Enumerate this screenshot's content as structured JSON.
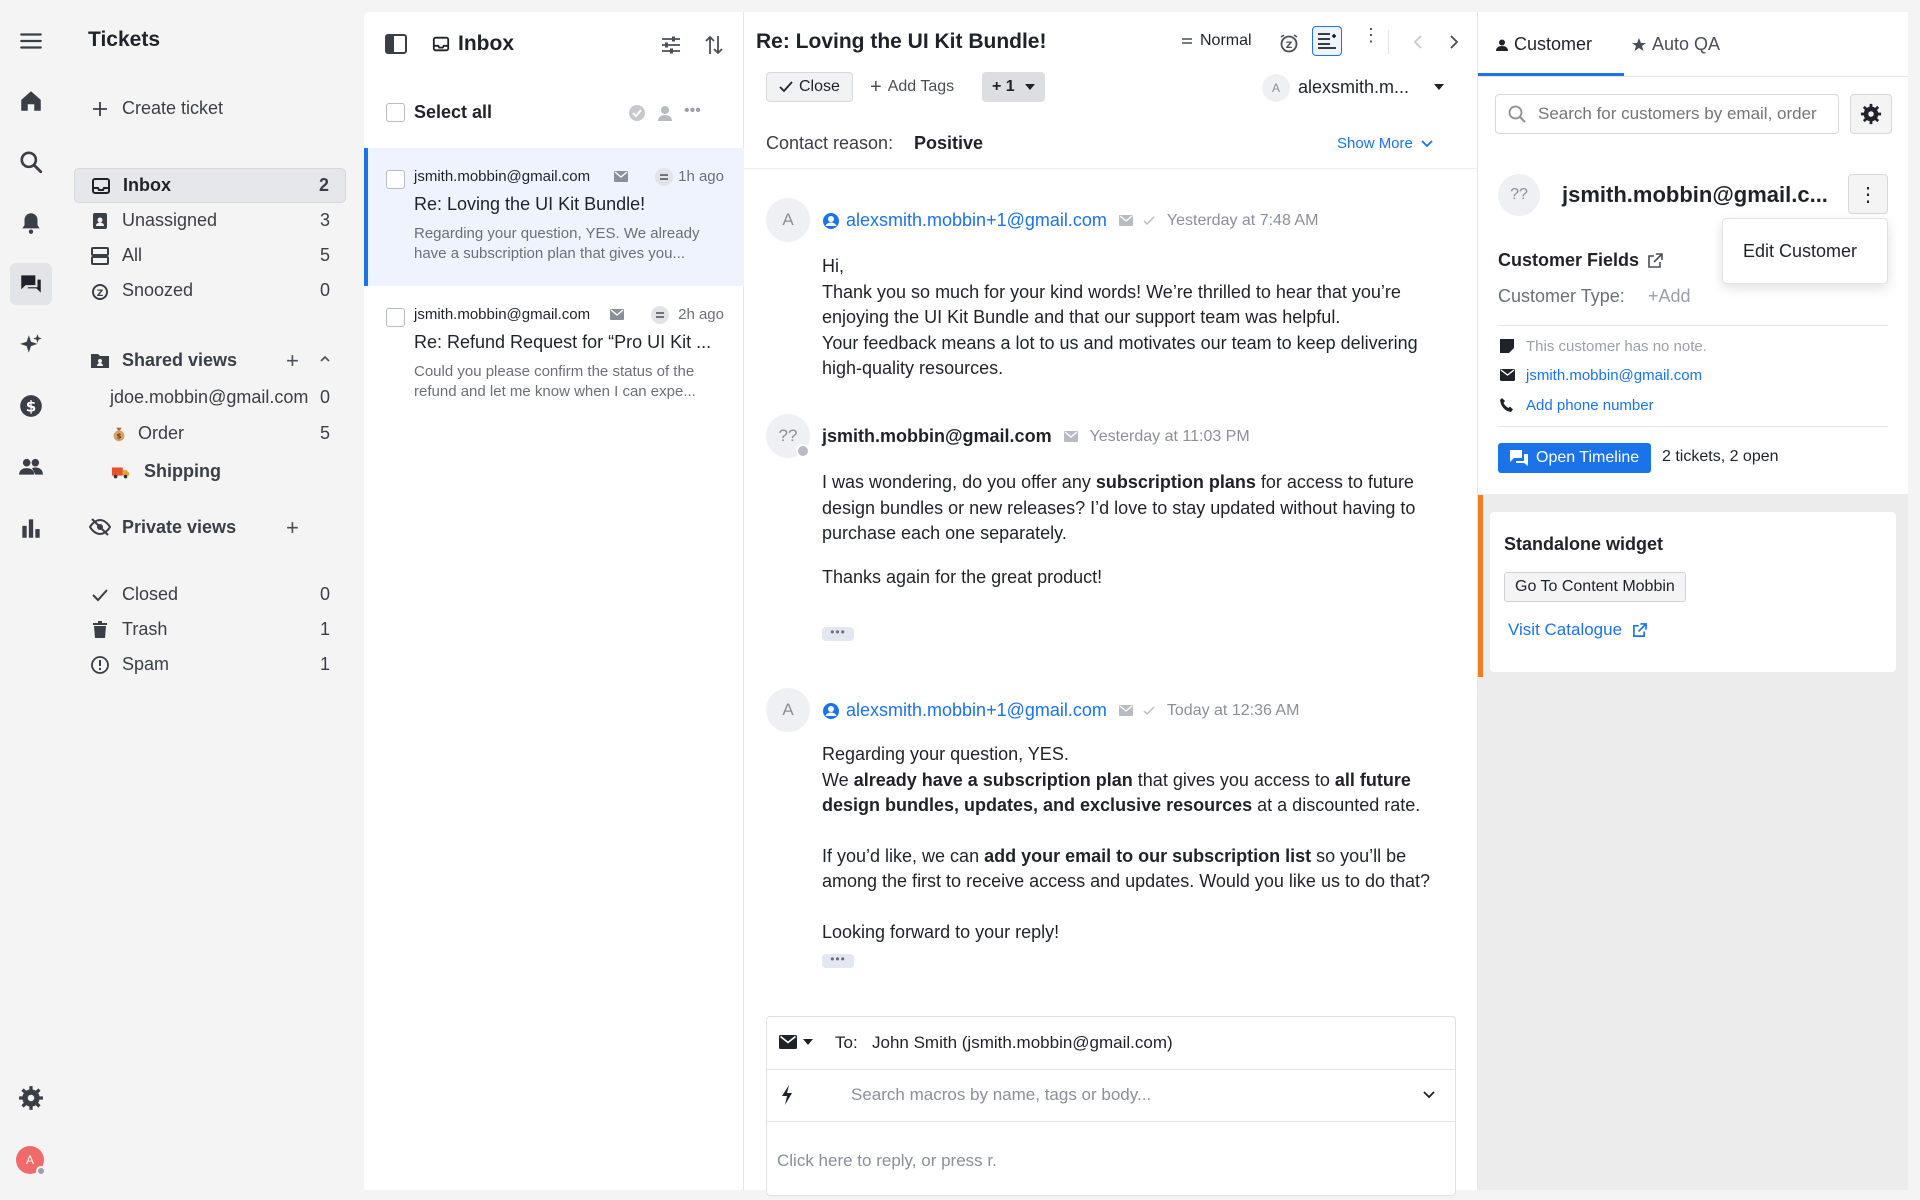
{
  "nav": {
    "title": "Tickets",
    "create_ticket": "Create ticket",
    "items": [
      {
        "label": "Inbox",
        "count": "2"
      },
      {
        "label": "Unassigned",
        "count": "3"
      },
      {
        "label": "All",
        "count": "5"
      },
      {
        "label": "Snoozed",
        "count": "0"
      }
    ],
    "shared_views": {
      "label": "Shared views",
      "items": [
        {
          "label": "jdoe.mobbin@gmail.com",
          "count": "0"
        },
        {
          "label": "Order",
          "count": "5"
        },
        {
          "label": "Shipping",
          "count": ""
        }
      ]
    },
    "private_views": {
      "label": "Private views"
    },
    "system_items": [
      {
        "label": "Closed",
        "count": "0"
      },
      {
        "label": "Trash",
        "count": "1"
      },
      {
        "label": "Spam",
        "count": "1"
      }
    ]
  },
  "user": {
    "initial": "A"
  },
  "list": {
    "title": "Inbox",
    "select_all": "Select all",
    "tickets": [
      {
        "from": "jsmith.mobbin@gmail.com",
        "time": "1h ago",
        "subject": "Re: Loving the UI Kit Bundle!",
        "preview": "Regarding your question, YES. We already have a subscription plan that gives you..."
      },
      {
        "from": "jsmith.mobbin@gmail.com",
        "time": "2h ago",
        "subject": "Re: Refund Request for “Pro UI Kit ...",
        "preview": "Could you please confirm the status of the refund and let me know when I can expe..."
      }
    ]
  },
  "ticket": {
    "title": "Re: Loving the UI Kit Bundle!",
    "priority": "Normal",
    "close_label": "Close",
    "add_tags": "Add Tags",
    "tag_count": "+ 1",
    "assignee_initial": "A",
    "assignee": "alexsmith.m...",
    "contact_reason_label": "Contact reason:",
    "contact_reason_value": "Positive",
    "show_more": "Show More",
    "messages": [
      {
        "avatar": "A",
        "from": "alexsmith.mobbin+1@gmail.com",
        "time": "Yesterday at 7:48 AM",
        "lines": [
          "Hi,",
          "Thank you so much for your kind words! We’re thrilled to hear that you’re enjoying the UI Kit Bundle and that our support team was helpful.",
          "Your feedback means a lot to us and motivates our team to keep delivering high-quality resources."
        ]
      },
      {
        "avatar": "??",
        "from": "jsmith.mobbin@gmail.com",
        "time": "Yesterday at 11:03 PM",
        "p1_a": "I was wondering, do you offer any ",
        "p1_b": "subscription plans",
        "p1_c": " for access to future design bundles or new releases? I’d love to stay updated without having to purchase each one separately.",
        "p2": "Thanks again for the great product!",
        "more": "•••"
      },
      {
        "avatar": "A",
        "from": "alexsmith.mobbin+1@gmail.com",
        "time": "Today at 12:36 AM",
        "l1": "Regarding your question, YES.",
        "l2_a": "We ",
        "l2_b": "already have a subscription plan",
        "l2_c": " that gives you access to ",
        "l2_d": "all future design bundles, updates, and exclusive resources",
        "l2_e": " at a discounted rate.",
        "l3_a": "If you’d like, we can ",
        "l3_b": "add your email to our subscription list",
        "l3_c": " so you’ll be among the first to receive access and updates. Would you like us to do that?",
        "l4": "Looking forward to your reply!",
        "more": "•••"
      }
    ],
    "reply": {
      "to_label": "To:",
      "to_value": "John Smith (jsmith.mobbin@gmail.com)",
      "macro_placeholder": "Search macros by name, tags or body...",
      "reply_placeholder": "Click here to reply, or press r."
    }
  },
  "side": {
    "tabs": [
      "Customer",
      "Auto QA"
    ],
    "search_placeholder": "Search for customers by email, order",
    "customer_avatar": "??",
    "customer_name": "jsmith.mobbin@gmail.c...",
    "menu_item": "Edit Customer",
    "fields_label": "Customer Fields",
    "type_label": "Customer Type:",
    "type_add": "+Add",
    "note": "This customer has no note.",
    "email": "jsmith.mobbin@gmail.com",
    "add_phone": "Add phone number",
    "open_timeline": "Open Timeline",
    "ticket_summary": "2 tickets, 2 open",
    "widget_title": "Standalone widget",
    "widget_button": "Go To Content Mobbin",
    "widget_link": "Visit Catalogue"
  },
  "colors": {
    "accent": "#1a73e8",
    "widget_border": "#f47c20"
  }
}
